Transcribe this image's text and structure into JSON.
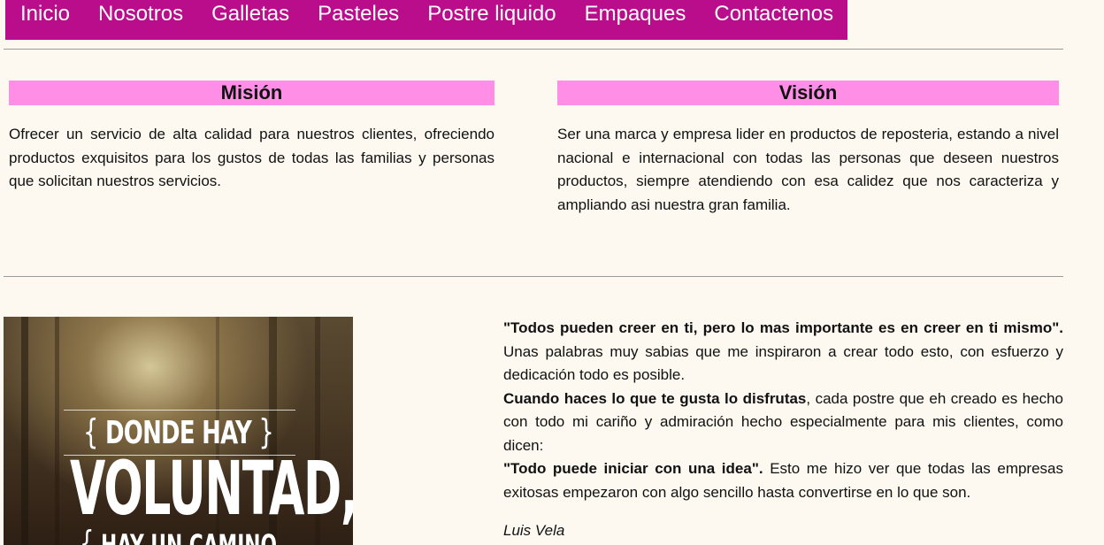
{
  "nav": {
    "items": [
      "Inicio",
      "Nosotros",
      "Galletas",
      "Pasteles",
      "Postre liquido",
      "Empaques",
      "Contactenos"
    ]
  },
  "mission": {
    "title": "Misión",
    "text": "Ofrecer un servicio de alta calidad para nuestros clientes, ofreciendo productos exquisitos para los gustos de todas las familias y personas que solicitan nuestros servicios."
  },
  "vision": {
    "title": "Visión",
    "text": "Ser una marca y empresa lider en productos de reposteria, estando a nivel nacional e internacional con todas las personas que deseen nuestros productos, siempre atendiendo con esa calidez que nos caracteriza y ampliando asi nuestra gran familia."
  },
  "poster": {
    "line1": "DONDE HAY",
    "line2": "VOLUNTAD,",
    "line3": "HAY UN CAMINO",
    "brace_open": "{",
    "brace_close": "}"
  },
  "quotes": {
    "q1_bold": "\"Todos pueden creer en ti, pero lo mas importante es en creer en ti mismo\".",
    "q1_rest": " Unas palabras muy sabias que me inspiraron a crear todo esto, con esfuerzo y dedicación todo es posible.",
    "q2_bold": "Cuando haces lo que te gusta lo disfrutas",
    "q2_rest": ", cada postre que eh creado es hecho con todo mi cariño y admiración hecho especialmente para mis clientes, como dicen:",
    "q3_bold": "\"Todo puede iniciar con una idea\".",
    "q3_rest": " Esto me hizo ver que todas las empresas exitosas empezaron con algo sencillo hasta convertirse en lo que son."
  },
  "author": "Luis Vela",
  "colors": {
    "nav_bg": "#b90d8b",
    "title_bg": "#ff8fe6",
    "page_bg": "#fdf9f1"
  }
}
